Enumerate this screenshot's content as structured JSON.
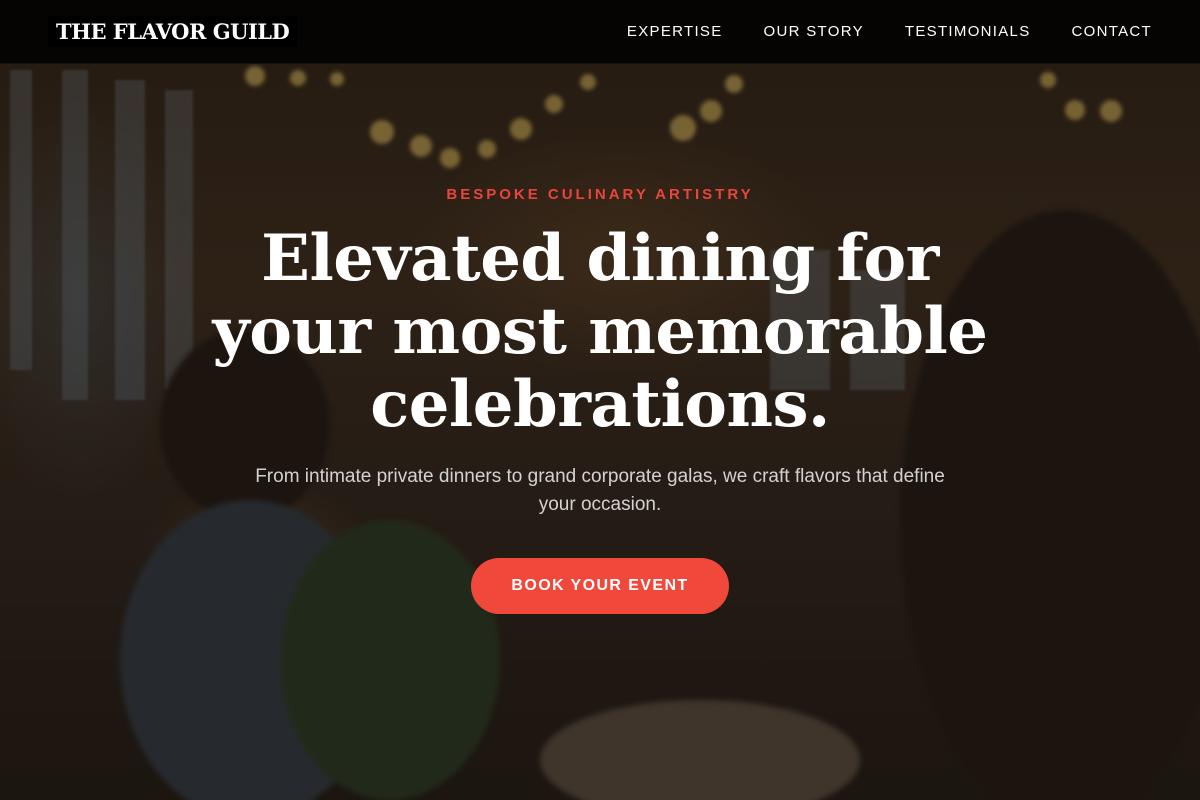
{
  "brand": {
    "logo_text": "THE FLAVOR GUILD"
  },
  "nav": {
    "items": [
      {
        "label": "EXPERTISE"
      },
      {
        "label": "OUR STORY"
      },
      {
        "label": "TESTIMONIALS"
      },
      {
        "label": "CONTACT"
      }
    ]
  },
  "hero": {
    "eyebrow": "BESPOKE CULINARY ARTISTRY",
    "headline": "Elevated dining for your most memorable celebrations.",
    "subtext": "From intimate private dinners to grand corporate galas, we craft flavors that define your occasion.",
    "cta_label": "BOOK YOUR EVENT"
  },
  "colors": {
    "accent": "#f0493c",
    "eyebrow": "#e8453c",
    "nav_background": "#000000",
    "text": "#ffffff"
  }
}
